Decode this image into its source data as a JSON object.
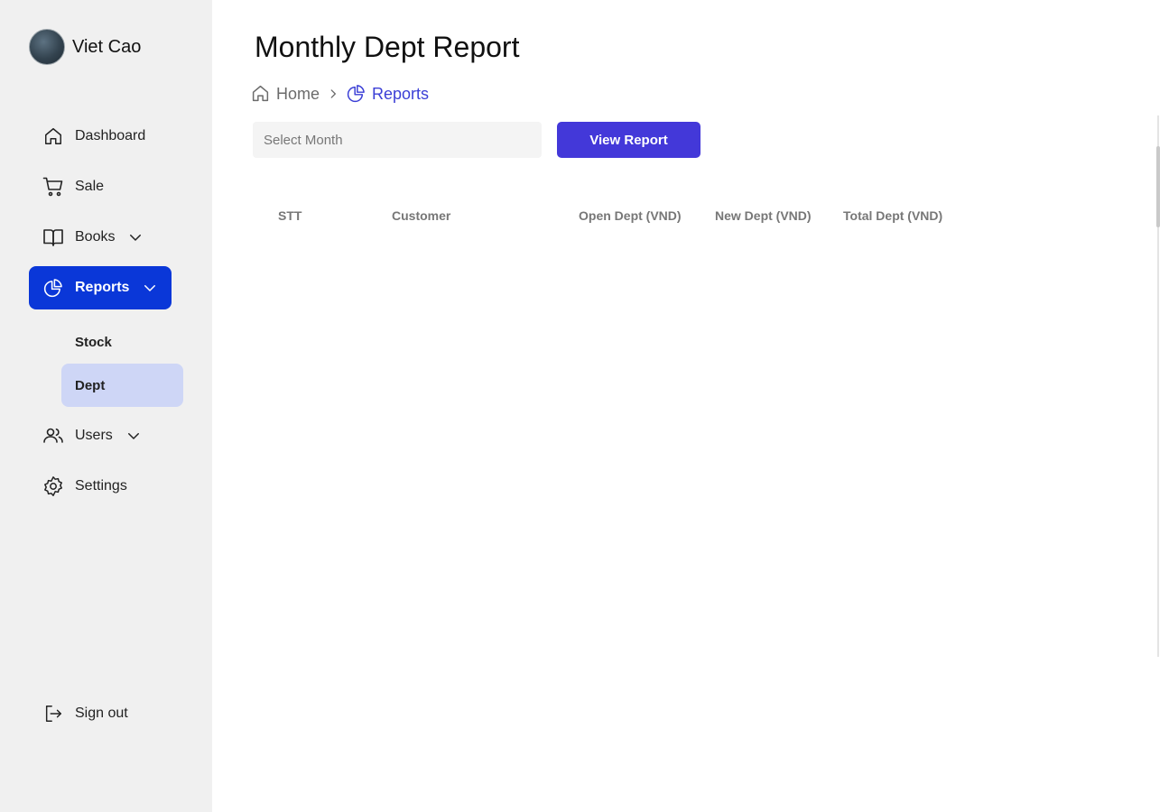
{
  "profile": {
    "name": "Viet Cao"
  },
  "sidebar": {
    "items": [
      {
        "label": "Dashboard",
        "icon": "home-icon"
      },
      {
        "label": "Sale",
        "icon": "cart-icon"
      },
      {
        "label": "Books",
        "icon": "book-icon"
      },
      {
        "label": "Reports",
        "icon": "pie-chart-icon"
      },
      {
        "label": "Users",
        "icon": "users-icon"
      },
      {
        "label": "Settings",
        "icon": "gear-icon"
      }
    ],
    "reports_sub": [
      {
        "label": "Stock"
      },
      {
        "label": "Dept"
      }
    ],
    "signout": {
      "label": "Sign out",
      "icon": "sign-out-icon"
    }
  },
  "main": {
    "title": "Monthly Dept Report",
    "breadcrumb": {
      "home": "Home",
      "current": "Reports"
    },
    "month_input": {
      "placeholder": "Select Month",
      "value": ""
    },
    "view_button": "View Report",
    "table": {
      "columns": [
        "STT",
        "Customer",
        "Open Dept (VND)",
        "New Dept (VND)",
        "Total Dept (VND)"
      ],
      "rows": []
    }
  },
  "colors": {
    "sidebar_bg": "#f0f0f0",
    "active_nav": "#0a37d8",
    "selected_sub": "#ced6f6",
    "primary_button": "#4338d9",
    "breadcrumb_active": "#3b3fd6"
  }
}
